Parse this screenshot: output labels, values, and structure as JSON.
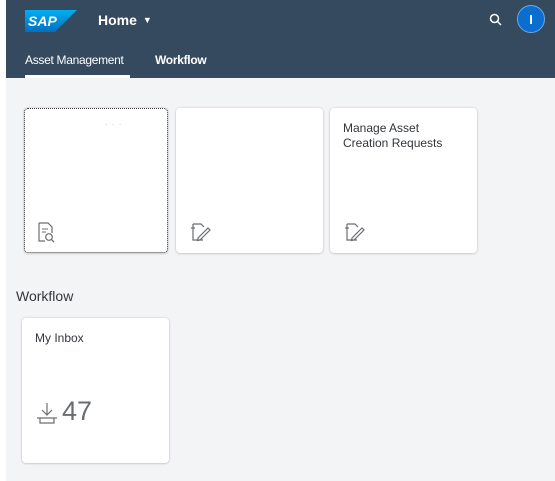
{
  "shell": {
    "logo_text": "SAP",
    "home_label": "Home",
    "avatar_initials": "I"
  },
  "tabs": [
    {
      "label": "Asset Management",
      "selected": true
    },
    {
      "label": "Workflow",
      "selected": false
    }
  ],
  "tiles": [
    {
      "title": "",
      "placeholder": "· · ·",
      "icon": "search-document-icon"
    },
    {
      "title": "",
      "icon": "edit-document-icon"
    },
    {
      "title": "Manage Asset Creation Requests",
      "icon": "edit-document-icon"
    }
  ],
  "workflow_section": {
    "title": "Workflow",
    "tiles": [
      {
        "title": "My Inbox",
        "icon": "download-tray-icon",
        "value": "47"
      }
    ]
  },
  "colors": {
    "shell_bg": "#354a5f",
    "content_bg": "#f3f4f5",
    "accent": "#0a6ed1"
  }
}
